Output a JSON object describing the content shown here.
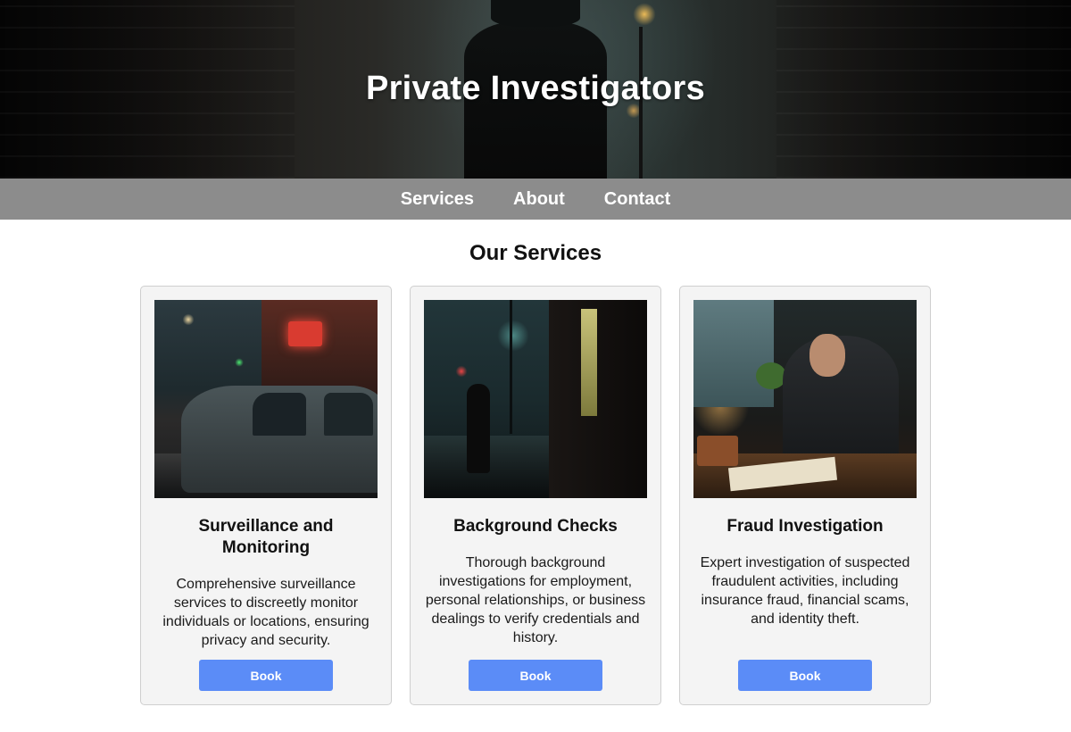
{
  "hero": {
    "title": "Private Investigators"
  },
  "nav": {
    "items": [
      {
        "label": "Services"
      },
      {
        "label": "About"
      },
      {
        "label": "Contact"
      }
    ]
  },
  "services": {
    "heading": "Our Services",
    "cards": [
      {
        "title": "Surveillance and Monitoring",
        "description": "Comprehensive surveillance services to discreetly monitor individuals or locations, ensuring privacy and security.",
        "button_label": "Book"
      },
      {
        "title": "Background Checks",
        "description": "Thorough background investigations for employment, personal relationships, or business dealings to verify credentials and history.",
        "button_label": "Book"
      },
      {
        "title": "Fraud Investigation",
        "description": "Expert investigation of suspected fraudulent activities, including insurance fraud, financial scams, and identity theft.",
        "button_label": "Book"
      }
    ]
  },
  "colors": {
    "nav_background": "#8c8c8c",
    "button_background": "#5b8cf7",
    "card_background": "#f4f4f4"
  }
}
